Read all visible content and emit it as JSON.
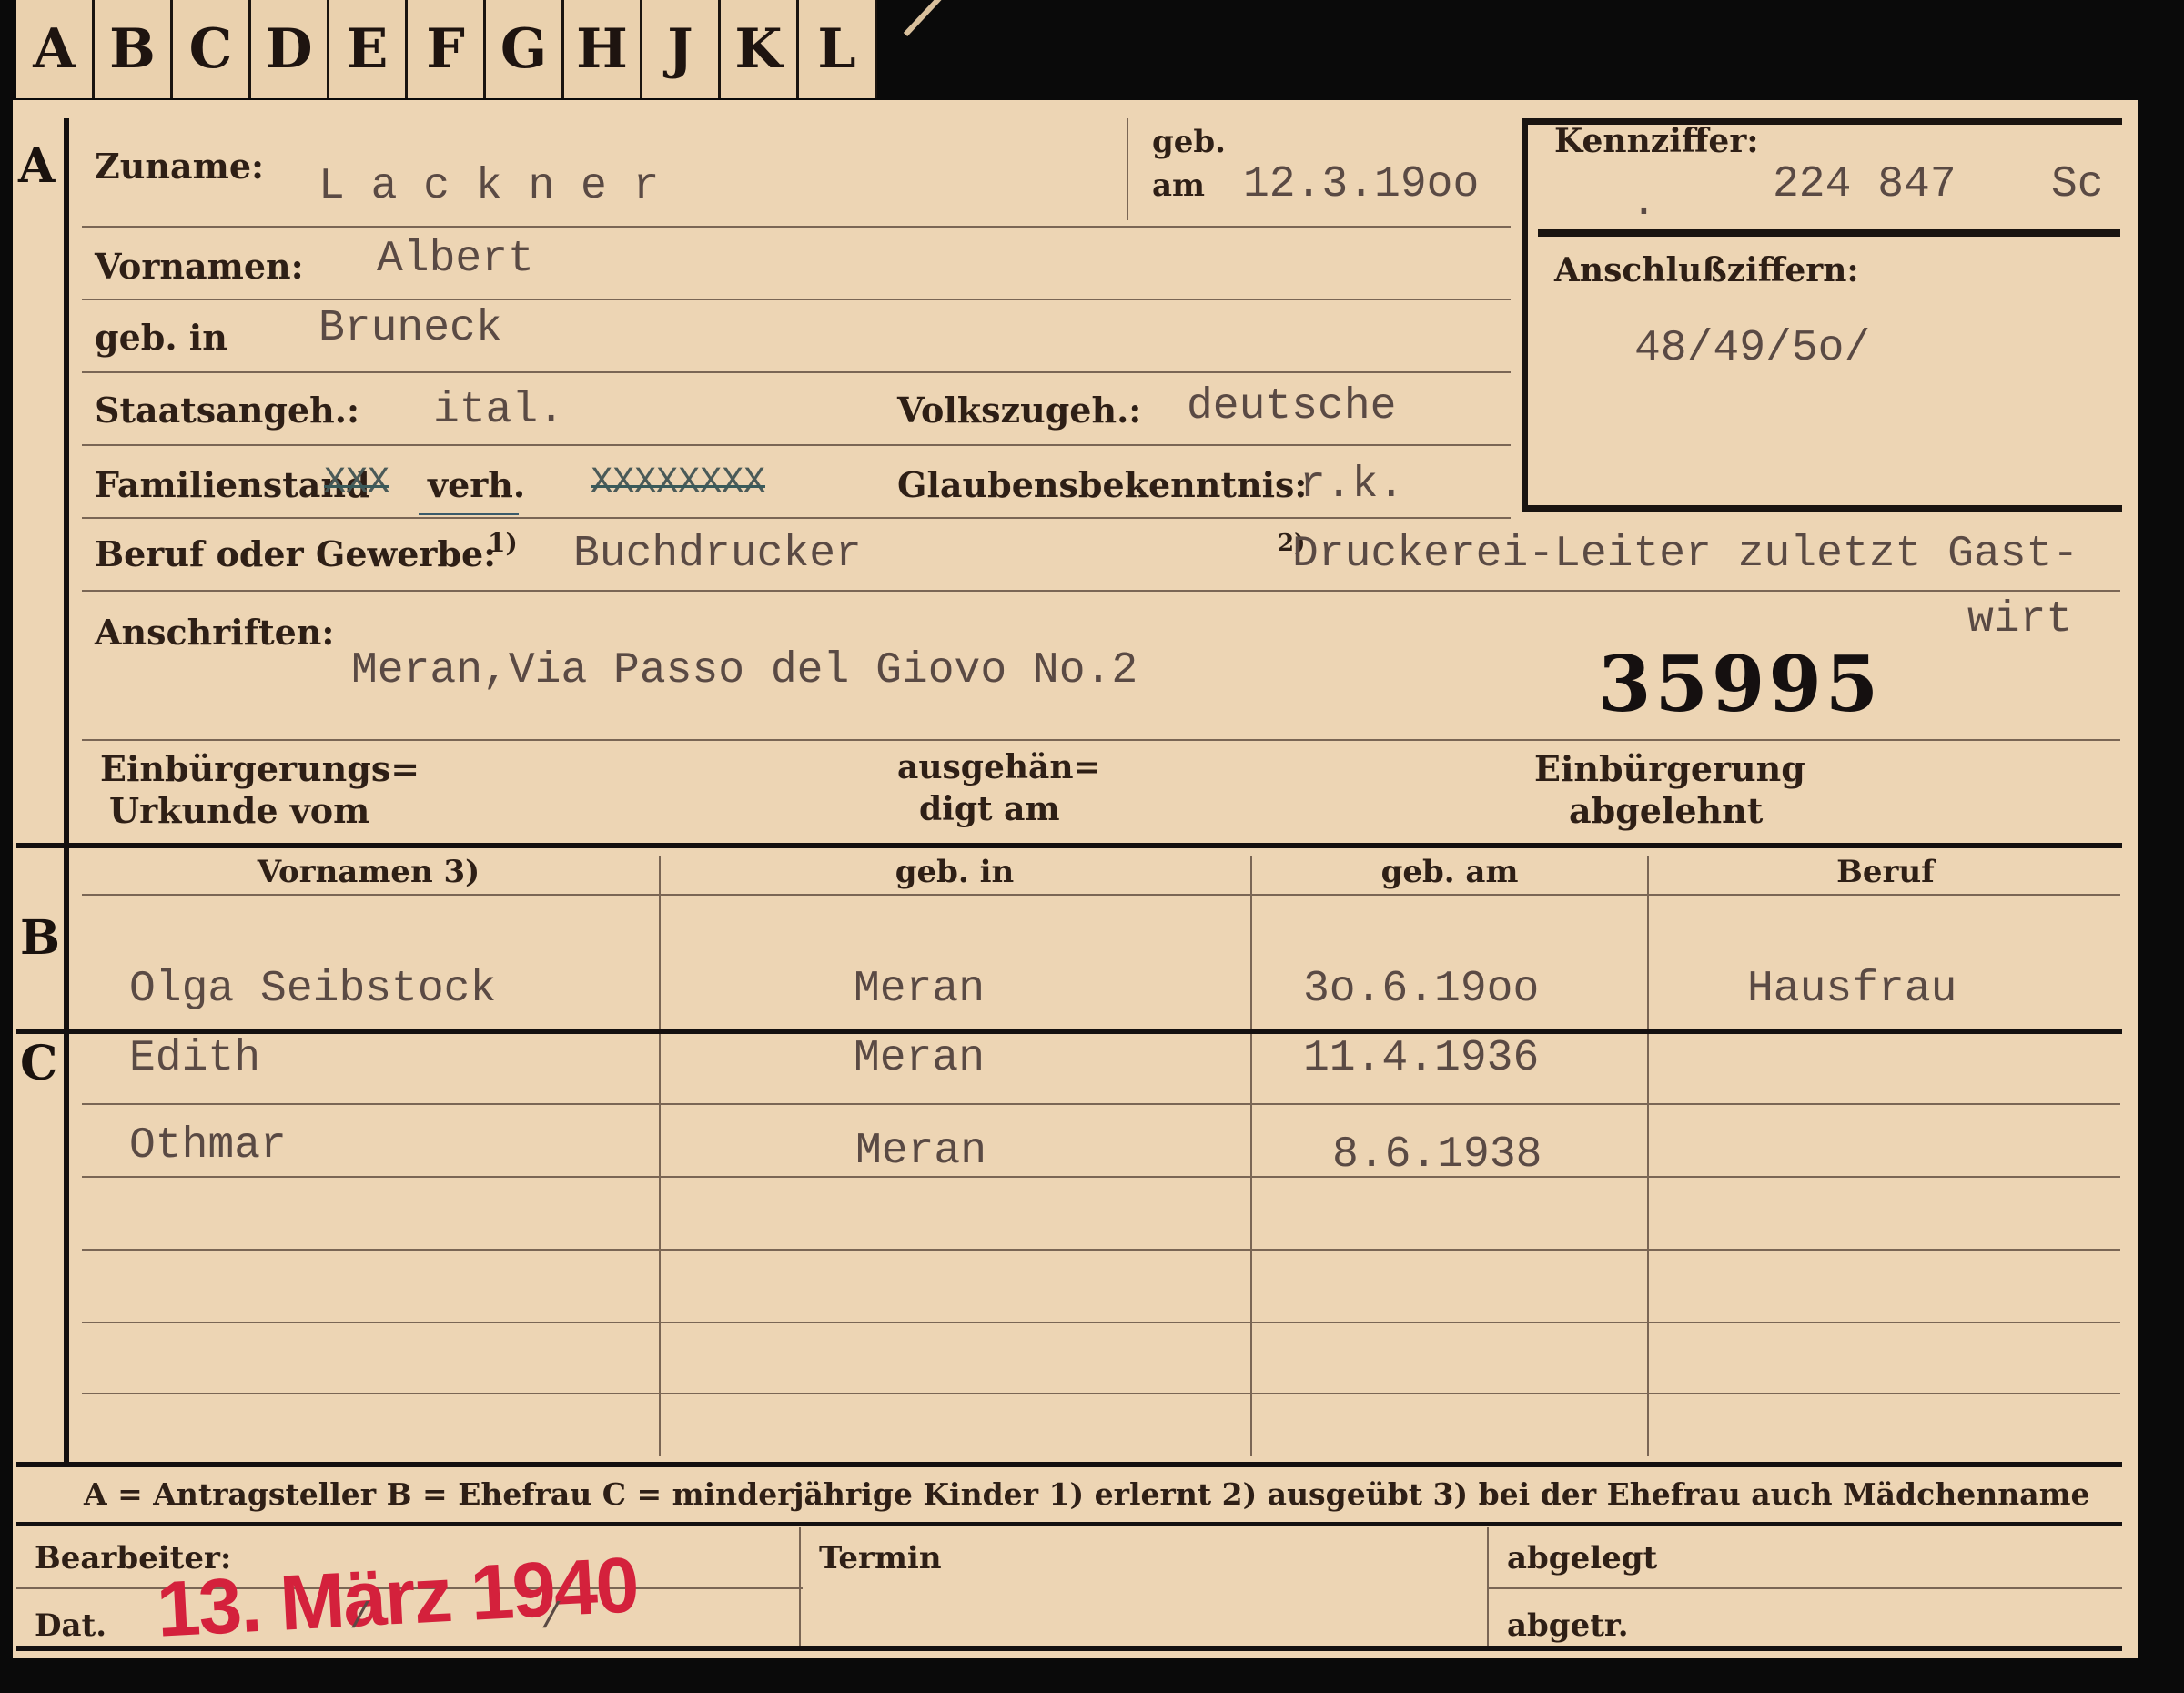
{
  "tabs": [
    "A",
    "B",
    "C",
    "D",
    "E",
    "F",
    "G",
    "H",
    "J",
    "K",
    "L"
  ],
  "sections": {
    "a": "A",
    "b": "B",
    "c": "C"
  },
  "applicant": {
    "surname_label": "Zuname:",
    "surname": "L a c k n e r",
    "born_label_1": "geb.",
    "born_label_2": "am",
    "born_date": "12.3.19oo",
    "firstname_label": "Vornamen:",
    "firstname": "Albert",
    "birthplace_label": "geb. in",
    "birthplace": "Bruneck",
    "citizenship_label": "Staatsangeh.:",
    "citizenship": "ital.",
    "ethnicity_label": "Volkszugeh.:",
    "ethnicity": "deutsche",
    "marital_label": "Familienstand",
    "marital_options_crossed_1": "XXX",
    "marital_selected": "verh.",
    "marital_options_crossed_2": "XXXXXXXX",
    "religion_label": "Glaubensbekenntnis:",
    "religion": "r.k.",
    "profession_label": "Beruf oder Gewerbe:",
    "profession_note": "1)",
    "profession": "Buchdrucker",
    "profession2_note": "2)",
    "profession2_line1": "Druckerei-Leiter zuletzt Gast-",
    "profession2_line2": "wirt",
    "address_label": "Anschriften:",
    "address": "Meran,Via Passo del Giovo No.2",
    "file_number": "35995",
    "naturalization_cert_label_1": "Einbürgerungs=",
    "naturalization_cert_label_2": "Urkunde vom",
    "handed_label_1": "ausgehän=",
    "handed_label_2": "digt am",
    "rejected_label_1": "Einbürgerung",
    "rejected_label_2": "abgelehnt"
  },
  "kennziffer": {
    "label": "Kennziffer:",
    "dot": ".",
    "value": "224 847",
    "suffix": "Sc",
    "anschluss_label": "Anschlußziffern:",
    "anschluss_value": "48/49/5o/"
  },
  "table": {
    "headers": [
      "Vornamen 3)",
      "geb. in",
      "geb. am",
      "Beruf"
    ],
    "wife": {
      "name": "Olga Seibstock",
      "place": "Meran",
      "date": "3o.6.19oo",
      "job": "Hausfrau"
    },
    "children": [
      {
        "name": "Edith",
        "place": "Meran",
        "date": "11.4.1936"
      },
      {
        "name": "Othmar",
        "place": "Meran",
        "date": "8.6.1938"
      }
    ]
  },
  "legend": "A = Antragsteller   B = Ehefrau   C = minderjährige Kinder   1) erlernt   2) ausgeübt   3) bei der Ehefrau auch Mädchenname",
  "footer": {
    "bearbeiter_label": "Bearbeiter:",
    "termin_label": "Termin",
    "abgelegt_label": "abgelegt",
    "dat_label": "Dat.",
    "abgetr_label": "abgetr.",
    "stamp": "13. März 1940",
    "slash1": "/",
    "slash2": "/"
  }
}
